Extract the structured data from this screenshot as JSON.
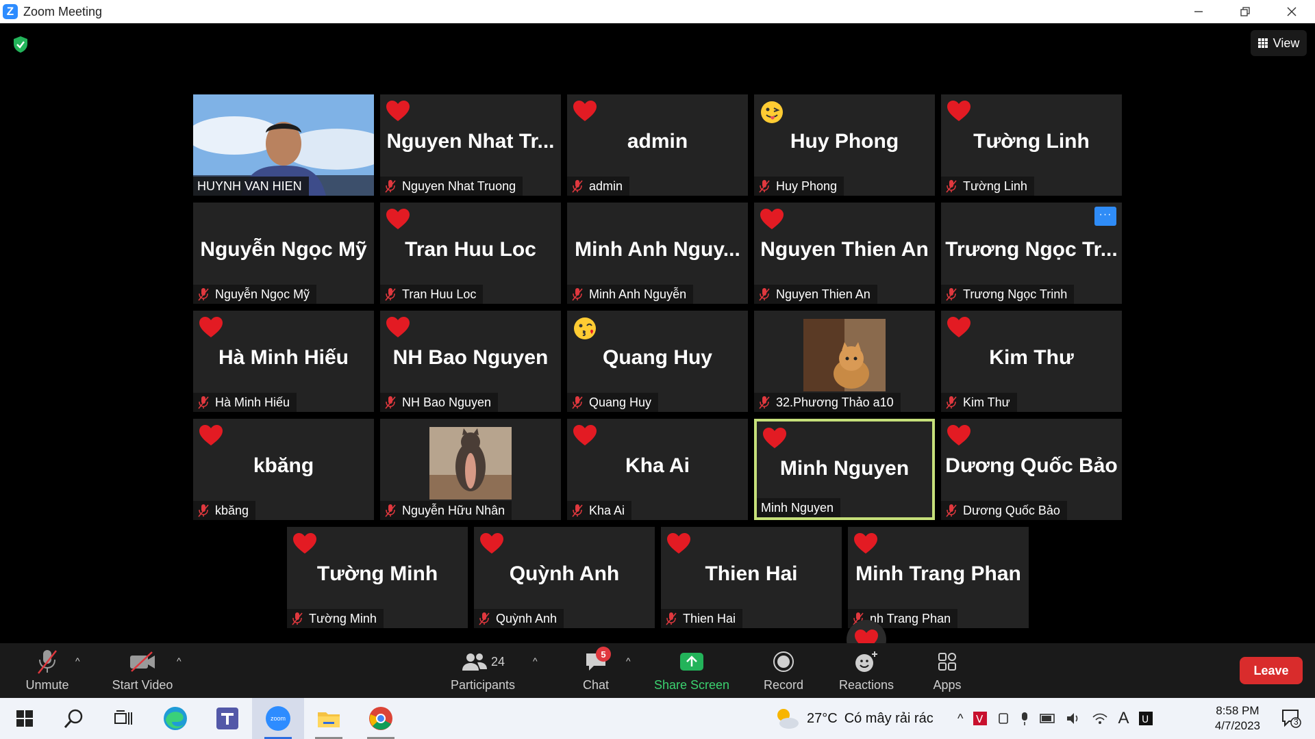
{
  "window": {
    "title": "Zoom Meeting"
  },
  "view_label": "View",
  "tiles_row1": [
    {
      "big": "",
      "label": "HUYNH VAN HIEN",
      "type": "video"
    },
    {
      "big": "Nguyen  Nhat  Tr...",
      "label": "Nguyen Nhat Truong",
      "reaction": "heart"
    },
    {
      "big": "admin",
      "label": "admin",
      "reaction": "heart"
    },
    {
      "big": "Huy Phong",
      "label": "Huy Phong",
      "reaction": "tongue-emoji"
    },
    {
      "big": "Tường Linh",
      "label": "Tường Linh",
      "reaction": "heart"
    }
  ],
  "tiles_row2": [
    {
      "big": "Nguyễn Ngọc Mỹ",
      "label": "Nguyễn Ngọc Mỹ"
    },
    {
      "big": "Tran Huu Loc",
      "label": "Tran Huu Loc",
      "reaction": "heart"
    },
    {
      "big": "Minh  Anh  Nguy...",
      "label": "Minh Anh Nguyễn"
    },
    {
      "big": "Nguyen Thien An",
      "label": "Nguyen Thien An",
      "reaction": "heart"
    },
    {
      "big": "Trương  Ngọc  Tr...",
      "label": "Trương Ngọc Trinh",
      "more": "···"
    }
  ],
  "tiles_row3": [
    {
      "big": "Hà Minh Hiếu",
      "label": "Hà Minh Hiếu",
      "reaction": "heart"
    },
    {
      "big": "NH Bao Nguyen",
      "label": "NH Bao Nguyen",
      "reaction": "heart"
    },
    {
      "big": "Quang Huy",
      "label": "Quang Huy",
      "reaction": "kiss-emoji"
    },
    {
      "big": "",
      "label": "32.Phương Thảo a10",
      "type": "cat-photo"
    },
    {
      "big": "Kim Thư",
      "label": "Kim Thư",
      "reaction": "heart"
    }
  ],
  "tiles_row4": [
    {
      "big": "kbăng",
      "label": "kbăng",
      "reaction": "heart"
    },
    {
      "big": "",
      "label": "Nguyễn Hữu Nhân",
      "type": "cat-photo"
    },
    {
      "big": "Kha Ai",
      "label": "Kha Ai",
      "reaction": "heart"
    },
    {
      "big": "Minh Nguyen",
      "label": "Minh Nguyen",
      "reaction": "heart",
      "active": true
    },
    {
      "big": "Dương Quốc Bảo",
      "label": "Dương Quốc Bảo",
      "reaction": "heart"
    }
  ],
  "tiles_row5": [
    {
      "big": "Tường Minh",
      "label": "Tường Minh",
      "reaction": "heart"
    },
    {
      "big": "Quỳnh Anh",
      "label": "Quỳnh Anh",
      "reaction": "heart"
    },
    {
      "big": "Thien Hai",
      "label": "Thien Hai",
      "reaction": "heart"
    },
    {
      "big": "Minh Trang Phan",
      "label": "nh Trang Phan",
      "reaction": "heart"
    }
  ],
  "toolbar": {
    "unmute": "Unmute",
    "start_video": "Start Video",
    "participants": "Participants",
    "participants_count": "24",
    "chat": "Chat",
    "chat_badge": "5",
    "share": "Share Screen",
    "record": "Record",
    "reactions": "Reactions",
    "apps": "Apps",
    "leave": "Leave"
  },
  "taskbar": {
    "zoom_label": "zoom",
    "temperature": "27°C",
    "weather_text": "Có mây rải rác",
    "time": "8:58 PM",
    "date": "4/7/2023",
    "notification_count": "3",
    "input_lang": "A"
  },
  "colors": {
    "tile_bg": "#232323",
    "active_border": "#c6e07a",
    "share_green": "#3bd16f",
    "leave_red": "#d92c2c",
    "heart_red": "#e31b23",
    "zoom_blue": "#2d8cff"
  }
}
